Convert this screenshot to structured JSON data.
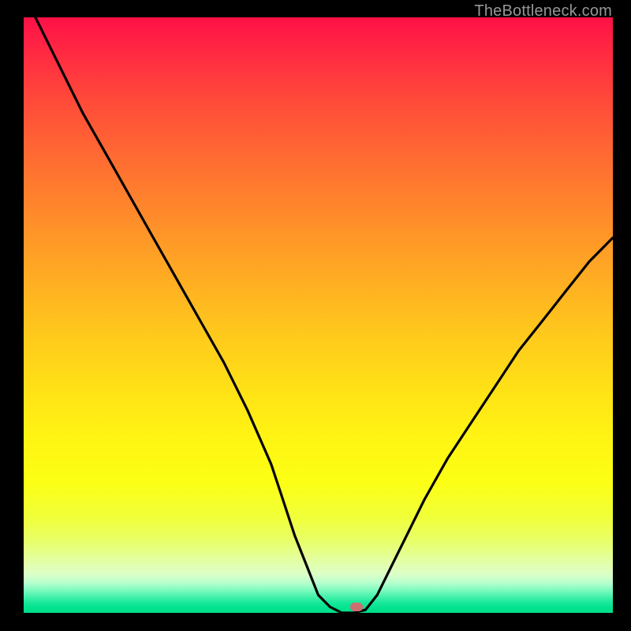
{
  "watermark": "TheBottleneck.com",
  "colors": {
    "page_bg": "#000000",
    "curve": "#000000",
    "marker": "#cc6f72",
    "watermark": "#969696"
  },
  "chart_data": {
    "type": "line",
    "title": "",
    "xlabel": "",
    "ylabel": "",
    "xlim": [
      0,
      100
    ],
    "ylim": [
      0,
      100
    ],
    "grid": false,
    "legend": false,
    "series": [
      {
        "name": "bottleneck-curve",
        "x": [
          2,
          6,
          10,
          14,
          18,
          22,
          26,
          30,
          34,
          38,
          42,
          44,
          46,
          48,
          50,
          52,
          54,
          56,
          58,
          60,
          64,
          68,
          72,
          76,
          80,
          84,
          88,
          92,
          96,
          100
        ],
        "values": [
          100,
          92,
          84,
          77,
          70,
          63,
          56,
          49,
          42,
          34,
          25,
          19,
          13,
          8,
          3,
          1,
          0,
          0,
          0.5,
          3,
          11,
          19,
          26,
          32,
          38,
          44,
          49,
          54,
          59,
          63
        ]
      }
    ],
    "marker": {
      "x": 56.5,
      "y": 0,
      "shape": "rounded-rect"
    },
    "background_gradient_stops": [
      {
        "pos": 0.0,
        "color": "#ff1047"
      },
      {
        "pos": 0.25,
        "color": "#ff7330"
      },
      {
        "pos": 0.5,
        "color": "#ffc61d"
      },
      {
        "pos": 0.75,
        "color": "#f6ff1a"
      },
      {
        "pos": 0.93,
        "color": "#e0ffb8"
      },
      {
        "pos": 1.0,
        "color": "#00de89"
      }
    ]
  }
}
